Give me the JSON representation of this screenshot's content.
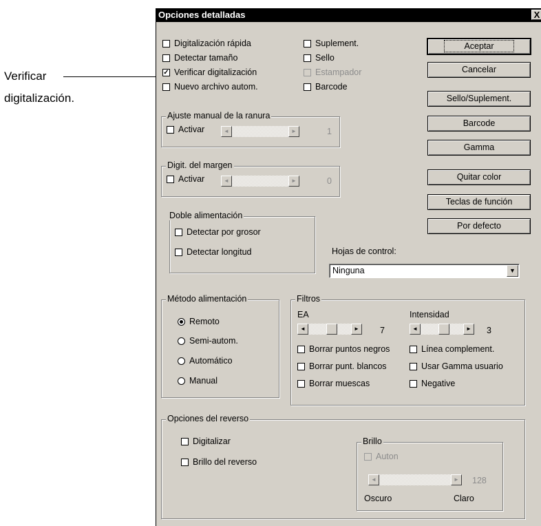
{
  "annotation": {
    "line1": "Verificar",
    "line2": "digitalización."
  },
  "dialog": {
    "title": "Opciones detalladas",
    "close": "X"
  },
  "options": {
    "col1": [
      {
        "label": "Digitalización rápida",
        "checked": false
      },
      {
        "label": "Detectar tamaño",
        "checked": false
      },
      {
        "label": "Verificar digitalización",
        "checked": true
      },
      {
        "label": "Nuevo archivo autom.",
        "checked": false
      }
    ],
    "col2": [
      {
        "label": "Suplement.",
        "checked": false
      },
      {
        "label": "Sello",
        "checked": false
      },
      {
        "label": "Estampador",
        "checked": false,
        "disabled": true
      },
      {
        "label": "Barcode",
        "checked": false
      }
    ]
  },
  "buttons": {
    "accept": "Aceptar",
    "cancel": "Cancelar",
    "stamp": "Sello/Suplement.",
    "barcode": "Barcode",
    "gamma": "Gamma",
    "dropout": "Quitar color",
    "function_keys": "Teclas de función",
    "default": "Por defecto"
  },
  "slot_adjust": {
    "title": "Ajuste manual de la ranura",
    "enable": "Activar",
    "value": "1"
  },
  "margin": {
    "title": "Digit. del margen",
    "enable": "Activar",
    "value": "0"
  },
  "double_feed": {
    "title": "Doble alimentación",
    "thickness": "Detectar por grosor",
    "length": "Detectar longitud"
  },
  "control_sheets": {
    "label": "Hojas de control:",
    "value": "Ninguna"
  },
  "feed_method": {
    "title": "Método alimentación",
    "options": [
      {
        "label": "Remoto",
        "selected": true
      },
      {
        "label": "Semi-autom.",
        "selected": false
      },
      {
        "label": "Automático",
        "selected": false
      },
      {
        "label": "Manual",
        "selected": false
      }
    ]
  },
  "filters": {
    "title": "Filtros",
    "ea_label": "EA",
    "ea_value": "7",
    "intensity_label": "Intensidad",
    "intensity_value": "3",
    "checks": [
      "Borrar puntos negros",
      "Línea complement.",
      "Borrar punt. blancos",
      "Usar Gamma usuario",
      "Borrar muescas",
      "Negative"
    ]
  },
  "reverse": {
    "title": "Opciones del reverso",
    "scan": "Digitalizar",
    "brightness_check": "Brillo del reverso",
    "brightness": {
      "title": "Brillo",
      "auto": "Auton",
      "value": "128",
      "dark": "Oscuro",
      "light": "Claro"
    }
  }
}
